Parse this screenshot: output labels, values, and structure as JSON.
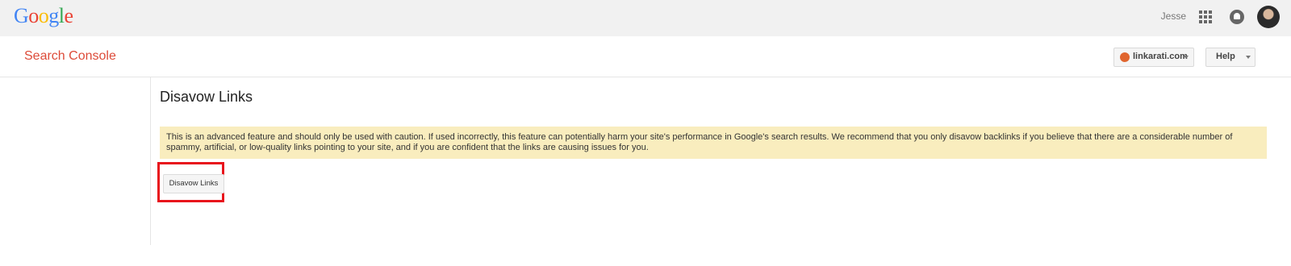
{
  "header": {
    "logo_letters": [
      "G",
      "o",
      "o",
      "g",
      "l",
      "e"
    ],
    "username": "Jesse",
    "icons": [
      "apps-icon",
      "notifications-icon",
      "avatar"
    ]
  },
  "subheader": {
    "product_title": "Search Console",
    "site_selector": {
      "value": "linkarati.com",
      "favicon_color": "#e0652e"
    },
    "help_label": "Help"
  },
  "main": {
    "page_title": "Disavow Links",
    "warning_text": "This is an advanced feature and should only be used with caution. If used incorrectly, this feature can potentially harm your site's performance in Google's search results. We recommend that you only disavow backlinks if you believe that there are a considerable number of spammy, artificial, or low-quality links pointing to your site, and if you are confident that the links are causing issues for you.",
    "disavow_button_label": "Disavow Links"
  },
  "colors": {
    "brand_red": "#dd4b39",
    "warning_background": "#f9edbe",
    "highlight_border": "#e8141c"
  }
}
